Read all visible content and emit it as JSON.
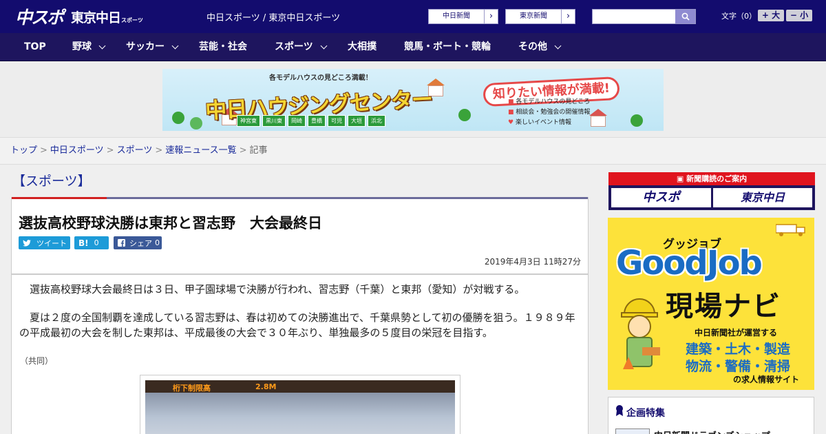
{
  "header": {
    "logo_main": "中スポ",
    "logo_sub": "東京中日",
    "logo_tiny": "スポーツ",
    "site_names": "中日スポーツ / 東京中日スポーツ",
    "links": [
      {
        "label": "中日新聞"
      },
      {
        "label": "東京新聞"
      }
    ],
    "search_placeholder": "",
    "font_label": "文字（0）",
    "font_plus": "+ 大",
    "font_minus": "− 小"
  },
  "nav": [
    {
      "label": "TOP",
      "dropdown": false
    },
    {
      "label": "野球",
      "dropdown": true
    },
    {
      "label": "サッカー",
      "dropdown": true
    },
    {
      "label": "芸能・社会",
      "dropdown": false
    },
    {
      "label": "スポーツ",
      "dropdown": true
    },
    {
      "label": "大相撲",
      "dropdown": false
    },
    {
      "label": "競馬・ボート・競輪",
      "dropdown": false
    },
    {
      "label": "その他",
      "dropdown": true
    }
  ],
  "banner": {
    "top_text": "各モデルハウスの見どころ満載！",
    "title": "中日ハウジングセンター",
    "bubble": "知りたい情報が満載!",
    "cities": [
      "神宮東",
      "黒川東",
      "岡崎",
      "豊橋",
      "可児",
      "大垣",
      "浜北"
    ],
    "list": [
      "各モデルハウスの見どころ",
      "相談会・勉強会の開催情報",
      "楽しいイベント情報"
    ]
  },
  "breadcrumb": {
    "items": [
      "トップ",
      "中日スポーツ",
      "スポーツ",
      "速報ニュース一覧"
    ],
    "current": "記事"
  },
  "article": {
    "section": "【スポーツ】",
    "headline": "選抜高校野球決勝は東邦と習志野　大会最終日",
    "share": {
      "tweet": "ツイート",
      "hatena_count": "0",
      "facebook": "シェア",
      "facebook_count": "0"
    },
    "datetime": "2019年4月3日 11時27分",
    "paragraphs": [
      "　選抜高校野球大会最終日は３日、甲子園球場で決勝が行われ、習志野（千葉）と東邦（愛知）が対戦する。",
      "　夏は２度の全国制覇を達成している習志野は、春は初めての決勝進出で、千葉県勢として初の優勝を狙う。１９８９年の平成最初の大会を制した東邦は、平成最後の大会で３０年ぶり、単独最多の５度目の栄冠を目指す。"
    ],
    "credit": "（共同）",
    "photo_sign": "桁下制限高",
    "photo_sign2": "2.8M"
  },
  "sidebar": {
    "subscribe_title": "新聞購読のご案内",
    "subscribe_buttons": [
      "中スポ",
      "東京中日"
    ],
    "goodjob": {
      "kana": "グッジョブ",
      "title": "GoodJob",
      "navi": "現場ナビ",
      "line1": "中日新聞社が運営する",
      "line2": "建築・土木・製造",
      "line3": "物流・警備・清掃",
      "line4": "の求人情報サイト"
    },
    "feature_title": "企画特集",
    "feature_item": "中日新聞ドラゴンズショップ"
  },
  "colors": {
    "header_bg": "#130c6e",
    "nav_bg": "#1e155e",
    "link": "#1a2b9a",
    "accent_red": "#d12020",
    "twitter": "#1d9bd8",
    "hatena": "#1d9bd8",
    "facebook": "#3b5998"
  }
}
